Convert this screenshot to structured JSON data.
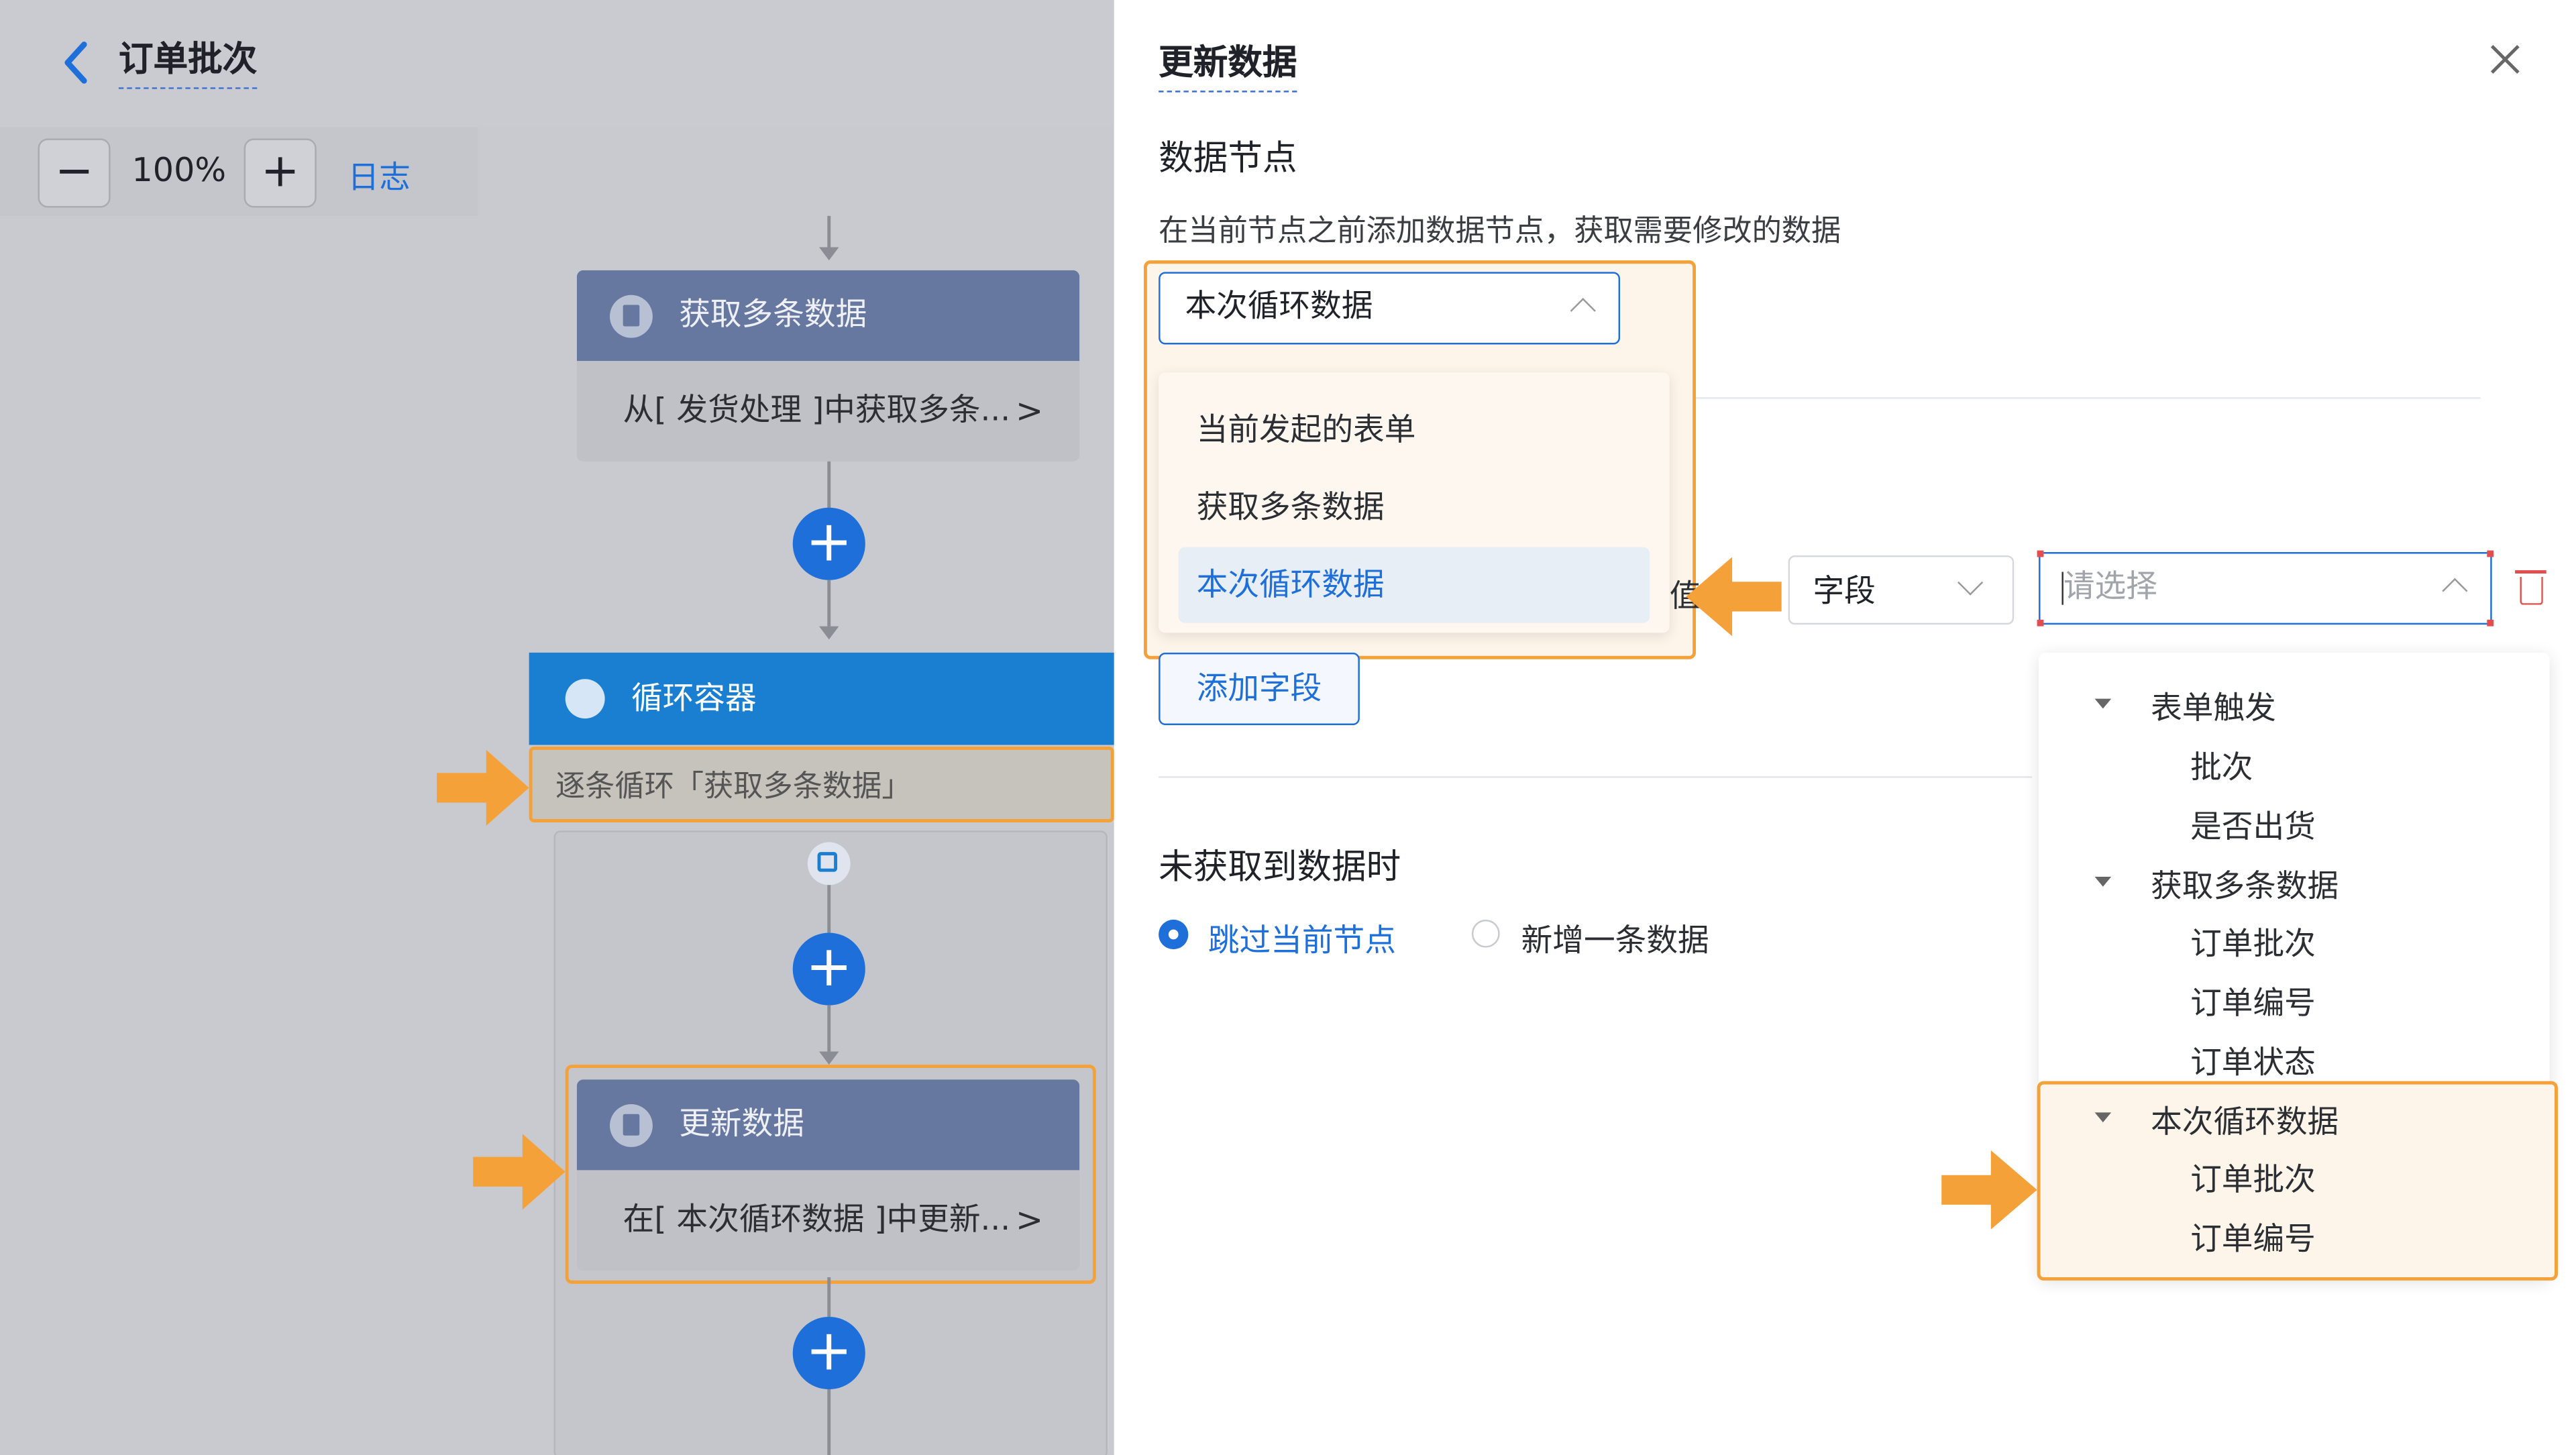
{
  "canvas": {
    "title": "订单批次",
    "zoom": "100%",
    "log_label": "日志",
    "node_fetch": {
      "title": "获取多条数据",
      "desc": "从[ 发货处理 ]中获取多条..."
    },
    "loop": {
      "title": "循环容器",
      "desc": "逐条循环「获取多条数据」"
    },
    "node_update": {
      "title": "更新数据",
      "desc": "在[ 本次循环数据 ]中更新..."
    }
  },
  "panel": {
    "title": "更新数据",
    "section_data_node": "数据节点",
    "hint": "在当前节点之前添加数据节点，获取需要修改的数据",
    "selected_node": "本次循环数据",
    "dropdown_options": [
      "当前发起的表单",
      "获取多条数据",
      "本次循环数据"
    ],
    "value_partial": "值",
    "field_type": "字段",
    "picker_placeholder": "请选择",
    "add_field": "添加字段",
    "section_no_data": "未获取到数据时",
    "radio_skip": "跳过当前节点",
    "radio_new": "新增一条数据",
    "tree": [
      {
        "group": "表单触发",
        "items": [
          "批次",
          "是否出货"
        ]
      },
      {
        "group": "获取多条数据",
        "items": [
          "订单批次",
          "订单编号",
          "订单状态"
        ]
      },
      {
        "group": "本次循环数据",
        "items": [
          "订单批次",
          "订单编号"
        ]
      }
    ]
  },
  "colors": {
    "accent": "#1e6fd9",
    "highlight": "#f5a13a",
    "danger": "#e34d4d"
  }
}
